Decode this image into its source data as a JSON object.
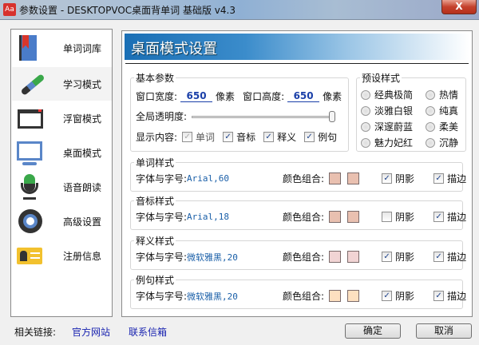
{
  "window": {
    "title": "参数设置 - DESKTOPVOC桌面背单词 基础版 v4.3",
    "app_icon": "Aa",
    "close": "X"
  },
  "sidebar": {
    "items": [
      {
        "label": "单词词库",
        "icon": "book-bookmark-icon"
      },
      {
        "label": "学习模式",
        "icon": "paintbrush-icon"
      },
      {
        "label": "浮窗模式",
        "icon": "window-icon"
      },
      {
        "label": "桌面模式",
        "icon": "monitor-icon"
      },
      {
        "label": "语音朗读",
        "icon": "microphone-icon"
      },
      {
        "label": "高级设置",
        "icon": "gear-icon"
      },
      {
        "label": "注册信息",
        "icon": "id-card-icon"
      }
    ],
    "selected": 1
  },
  "main": {
    "title": "桌面模式设置",
    "basic": {
      "label": "基本参数",
      "width_label": "窗口宽度:",
      "width": "650",
      "unit": "像素",
      "height_label": "窗口高度:",
      "height": "650",
      "unit2": "像素",
      "opacity_label": "全局透明度:",
      "opacity": 1.0,
      "display_label": "显示内容:",
      "display": [
        {
          "label": "单词",
          "checked": true,
          "disabled": true
        },
        {
          "label": "音标",
          "checked": true
        },
        {
          "label": "释义",
          "checked": true
        },
        {
          "label": "例句",
          "checked": true
        }
      ]
    },
    "presets": {
      "label": "预设样式",
      "options": [
        "经典极简",
        "热情",
        "淡雅白银",
        "纯真",
        "深邃蔚蓝",
        "柔美",
        "魅力妃红",
        "沉静"
      ]
    },
    "styles": [
      {
        "label": "单词样式",
        "font_label": "字体与字号:",
        "font": "Arial,60",
        "color_label": "颜色组合:",
        "colors": [
          "#e9c0b0",
          "#e9c0b0"
        ],
        "shadow_label": "阴影",
        "shadow": true,
        "outline_label": "描边",
        "outline": true
      },
      {
        "label": "音标样式",
        "font_label": "字体与字号:",
        "font": "Arial,18",
        "color_label": "颜色组合:",
        "colors": [
          "#e9c0b0",
          "#e9c0b0"
        ],
        "shadow_label": "阴影",
        "shadow": false,
        "outline_label": "描边",
        "outline": true
      },
      {
        "label": "释义样式",
        "font_label": "字体与字号:",
        "font": "微软雅黑,20",
        "color_label": "颜色组合:",
        "colors": [
          "#f1d4d4",
          "#f1d4d4"
        ],
        "shadow_label": "阴影",
        "shadow": true,
        "outline_label": "描边",
        "outline": true
      },
      {
        "label": "例句样式",
        "font_label": "字体与字号:",
        "font": "微软雅黑,20",
        "color_label": "颜色组合:",
        "colors": [
          "#fde0c0",
          "#fde0c0"
        ],
        "shadow_label": "阴影",
        "shadow": true,
        "outline_label": "描边",
        "outline": true
      }
    ]
  },
  "footer": {
    "links_label": "相关链接:",
    "links": [
      "官方网站",
      "联系信箱"
    ],
    "ok": "确定",
    "cancel": "取消"
  }
}
